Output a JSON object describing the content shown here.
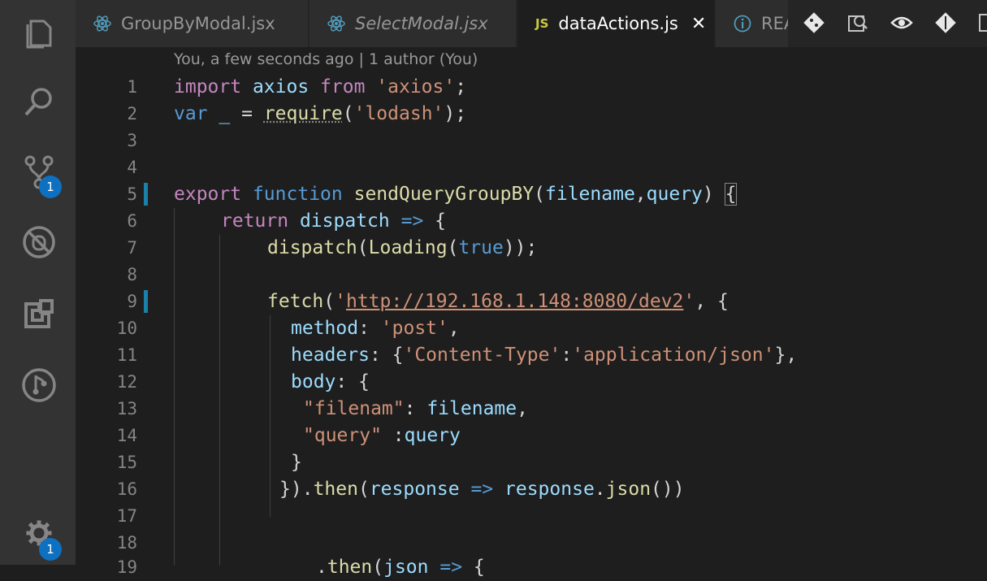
{
  "tabs": [
    {
      "label": "GroupByModal.jsx",
      "icon": "react-icon",
      "italic": false,
      "active": false
    },
    {
      "label": "SelectModal.jsx",
      "icon": "react-icon",
      "italic": true,
      "active": false
    },
    {
      "label": "dataActions.js",
      "icon": "js-icon",
      "icon_text": "JS",
      "italic": false,
      "active": true
    },
    {
      "label": "REA",
      "icon": "info-icon",
      "italic": false,
      "active": false
    }
  ],
  "editor_actions": [
    "git-compare-icon",
    "open-preview-icon",
    "inline-view-icon",
    "git-commit-icon",
    "split-editor-icon"
  ],
  "activity_bar": [
    {
      "name": "explorer-icon"
    },
    {
      "name": "search-icon"
    },
    {
      "name": "source-control-icon",
      "badge": "1"
    },
    {
      "name": "debug-icon"
    },
    {
      "name": "extensions-icon"
    },
    {
      "name": "gitlens-icon"
    },
    {
      "name": "settings-icon",
      "badge": "1"
    }
  ],
  "blame": "You, a few seconds ago | 1 author (You)",
  "line_numbers": [
    "1",
    "2",
    "3",
    "4",
    "5",
    "6",
    "7",
    "8",
    "9",
    "10",
    "11",
    "12",
    "13",
    "14",
    "15",
    "16",
    "17",
    "18",
    "19"
  ],
  "colors": {
    "accent": "#0e70c0",
    "keyword": "#c586c0",
    "string": "#ce9178",
    "variable": "#9cdcfe",
    "function": "#dcdcaa"
  },
  "code": {
    "l1": [
      "import",
      " axios ",
      "from",
      " ",
      "'axios'",
      ";"
    ],
    "l2": [
      "var",
      " ",
      "_",
      " = ",
      "require",
      "(",
      "'lodash'",
      ");"
    ],
    "l5": [
      "export",
      " ",
      "function",
      " ",
      "sendQueryGroupBY",
      "(",
      "filename",
      ",",
      "query",
      ") ",
      "{"
    ],
    "l6": [
      "return",
      " ",
      "dispatch",
      " ",
      "=>",
      " {"
    ],
    "l7": [
      "dispatch",
      "(",
      "Loading",
      "(",
      "true",
      "));"
    ],
    "l9": [
      "fetch",
      "(",
      "'",
      "http://192.168.1.148:8080/dev2",
      "'",
      ", {"
    ],
    "l10": [
      "method",
      ": ",
      "'post'",
      ","
    ],
    "l11": [
      "headers",
      ": {",
      "'Content-Type'",
      ":",
      "'application/json'",
      "},"
    ],
    "l12": [
      "body",
      ": {"
    ],
    "l13": [
      "\"filenam\"",
      ": ",
      "filename",
      ","
    ],
    "l14": [
      "\"query\"",
      " :",
      "query"
    ],
    "l15": [
      "}"
    ],
    "l16": [
      "})",
      ".",
      "then",
      "(",
      "response",
      " ",
      "=>",
      " ",
      "response",
      ".",
      "json",
      "())"
    ],
    "l19": [
      ".",
      "then",
      "(",
      "json",
      " ",
      "=>",
      " {"
    ]
  }
}
